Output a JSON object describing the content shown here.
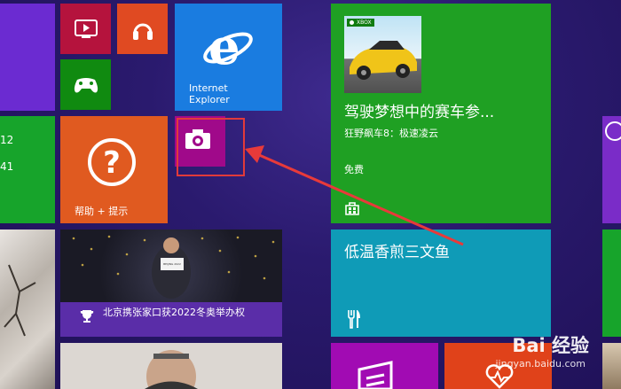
{
  "tiles": {
    "ie": {
      "label_line1": "Internet",
      "label_line2": "Explorer"
    },
    "help": {
      "label": "帮助 + 提示"
    },
    "game": {
      "brand": "XBOX",
      "title": "驾驶梦想中的赛车参...",
      "subtitle": "狂野飙车8：极速凌云",
      "price": "免费"
    },
    "food": {
      "title": "低温香煎三文鱼"
    },
    "news": {
      "headline": "北京携张家口获2022冬奥举办权",
      "sign_text": "BEIJING 2022"
    },
    "left_partial": {
      "line1": "12",
      "line2": "41"
    }
  },
  "watermark": {
    "main": "Bai 经验",
    "sub": "jingyan.baidu.com"
  },
  "colors": {
    "video": "#b5133d",
    "music": "#e04a22",
    "xbox_games": "#108a10",
    "ie": "#1a7ce0",
    "camera": "#a0098a",
    "help": "#e05a20",
    "game": "#1fa023",
    "food": "#0f9bb7",
    "left_top": "#6b2bd1",
    "left_mid": "#17a42b"
  }
}
